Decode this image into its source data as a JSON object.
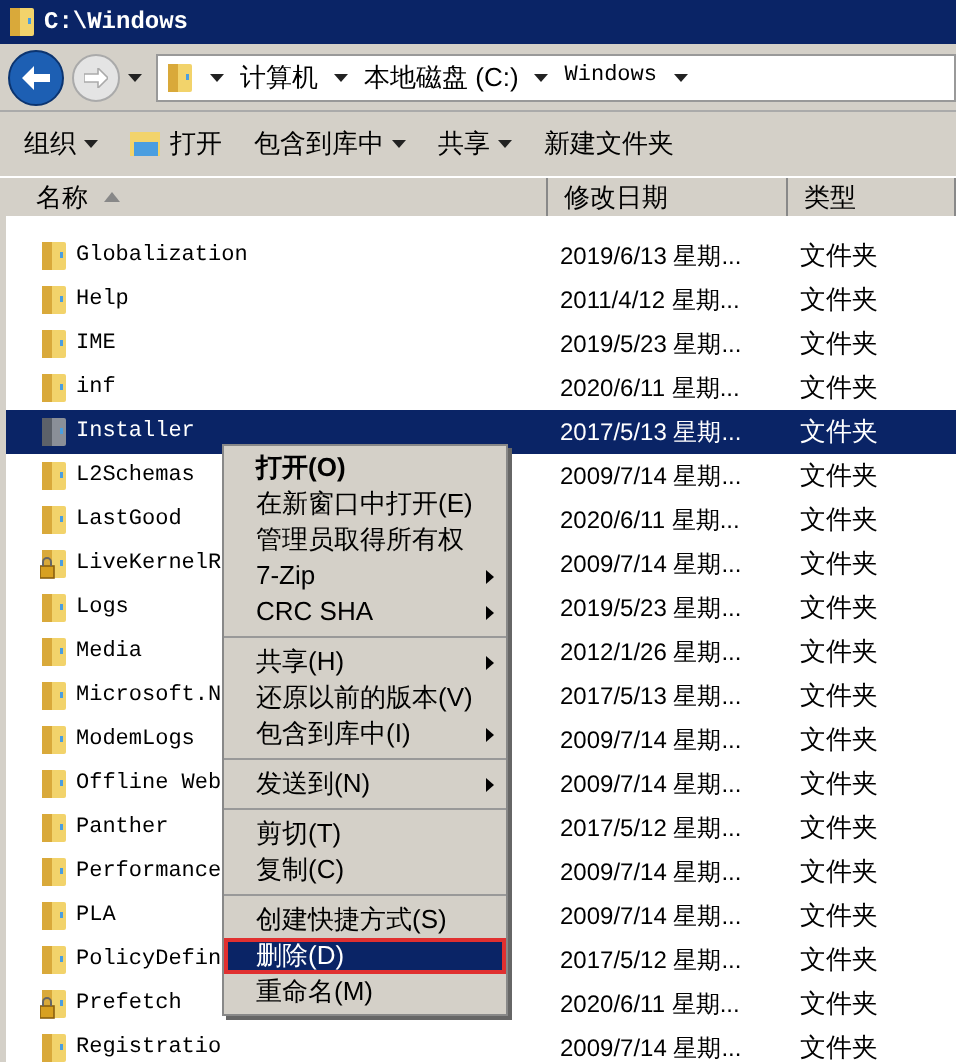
{
  "window": {
    "title": "C:\\Windows"
  },
  "address": {
    "crumbs": [
      "计算机",
      "本地磁盘 (C:)",
      "Windows"
    ]
  },
  "toolbar": [
    {
      "label": "组织",
      "dropdown": true,
      "icon": false
    },
    {
      "label": "打开",
      "dropdown": false,
      "icon": true
    },
    {
      "label": "包含到库中",
      "dropdown": true,
      "icon": false
    },
    {
      "label": "共享",
      "dropdown": true,
      "icon": false
    },
    {
      "label": "新建文件夹",
      "dropdown": false,
      "icon": false
    }
  ],
  "columns": [
    {
      "label": "名称",
      "sorted": true
    },
    {
      "label": "修改日期",
      "sorted": false
    },
    {
      "label": "类型",
      "sorted": false
    }
  ],
  "rows": [
    {
      "name": "Globalization",
      "date": "2019/6/13 星期...",
      "type": "文件夹",
      "kind": "folder",
      "selected": false
    },
    {
      "name": "Help",
      "date": "2011/4/12 星期...",
      "type": "文件夹",
      "kind": "folder",
      "selected": false
    },
    {
      "name": "IME",
      "date": "2019/5/23 星期...",
      "type": "文件夹",
      "kind": "folder",
      "selected": false
    },
    {
      "name": "inf",
      "date": "2020/6/11 星期...",
      "type": "文件夹",
      "kind": "folder",
      "selected": false
    },
    {
      "name": "Installer",
      "date": "2017/5/13 星期...",
      "type": "文件夹",
      "kind": "system",
      "selected": true
    },
    {
      "name": "L2Schemas",
      "date": "2009/7/14 星期...",
      "type": "文件夹",
      "kind": "folder",
      "selected": false
    },
    {
      "name": "LastGood",
      "date": "2020/6/11 星期...",
      "type": "文件夹",
      "kind": "folder",
      "selected": false
    },
    {
      "name": "LiveKernelR",
      "date": "2009/7/14 星期...",
      "type": "文件夹",
      "kind": "locked",
      "selected": false
    },
    {
      "name": "Logs",
      "date": "2019/5/23 星期...",
      "type": "文件夹",
      "kind": "folder",
      "selected": false
    },
    {
      "name": "Media",
      "date": "2012/1/26 星期...",
      "type": "文件夹",
      "kind": "folder",
      "selected": false
    },
    {
      "name": "Microsoft.N",
      "date": "2017/5/13 星期...",
      "type": "文件夹",
      "kind": "folder",
      "selected": false
    },
    {
      "name": "ModemLogs",
      "date": "2009/7/14 星期...",
      "type": "文件夹",
      "kind": "folder",
      "selected": false
    },
    {
      "name": "Offline Web",
      "date": "2009/7/14 星期...",
      "type": "文件夹",
      "kind": "folder",
      "selected": false
    },
    {
      "name": "Panther",
      "date": "2017/5/12 星期...",
      "type": "文件夹",
      "kind": "folder",
      "selected": false
    },
    {
      "name": "Performance",
      "date": "2009/7/14 星期...",
      "type": "文件夹",
      "kind": "folder",
      "selected": false
    },
    {
      "name": "PLA",
      "date": "2009/7/14 星期...",
      "type": "文件夹",
      "kind": "folder",
      "selected": false
    },
    {
      "name": "PolicyDefin",
      "date": "2017/5/12 星期...",
      "type": "文件夹",
      "kind": "folder",
      "selected": false
    },
    {
      "name": "Prefetch",
      "date": "2020/6/11 星期...",
      "type": "文件夹",
      "kind": "locked",
      "selected": false
    },
    {
      "name": "Registratio",
      "date": "2009/7/14 星期...",
      "type": "文件夹",
      "kind": "folder",
      "selected": false
    }
  ],
  "context_menu": {
    "groups": [
      [
        {
          "label": "打开(O)",
          "default": true,
          "submenu": false,
          "selected": false,
          "outlined": false
        },
        {
          "label": "在新窗口中打开(E)",
          "default": false,
          "submenu": false,
          "selected": false,
          "outlined": false
        },
        {
          "label": "管理员取得所有权",
          "default": false,
          "submenu": false,
          "selected": false,
          "outlined": false
        },
        {
          "label": "7-Zip",
          "default": false,
          "submenu": true,
          "selected": false,
          "outlined": false
        },
        {
          "label": "CRC SHA",
          "default": false,
          "submenu": true,
          "selected": false,
          "outlined": false
        }
      ],
      [
        {
          "label": "共享(H)",
          "default": false,
          "submenu": true,
          "selected": false,
          "outlined": false
        },
        {
          "label": "还原以前的版本(V)",
          "default": false,
          "submenu": false,
          "selected": false,
          "outlined": false
        },
        {
          "label": "包含到库中(I)",
          "default": false,
          "submenu": true,
          "selected": false,
          "outlined": false
        }
      ],
      [
        {
          "label": "发送到(N)",
          "default": false,
          "submenu": true,
          "selected": false,
          "outlined": false
        }
      ],
      [
        {
          "label": "剪切(T)",
          "default": false,
          "submenu": false,
          "selected": false,
          "outlined": false
        },
        {
          "label": "复制(C)",
          "default": false,
          "submenu": false,
          "selected": false,
          "outlined": false
        }
      ],
      [
        {
          "label": "创建快捷方式(S)",
          "default": false,
          "submenu": false,
          "selected": false,
          "outlined": false
        },
        {
          "label": "删除(D)",
          "default": false,
          "submenu": false,
          "selected": true,
          "outlined": true
        },
        {
          "label": "重命名(M)",
          "default": false,
          "submenu": false,
          "selected": false,
          "outlined": false
        }
      ]
    ]
  }
}
